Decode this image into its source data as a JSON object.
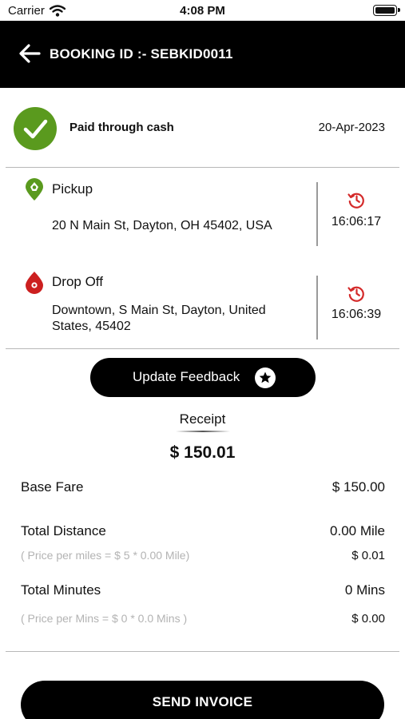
{
  "status_bar": {
    "carrier": "Carrier",
    "time": "4:08 PM"
  },
  "header": {
    "title": "BOOKING ID :- SEBKID0011",
    "back_icon": "arrow-left-icon"
  },
  "payment": {
    "label": "Paid through cash",
    "date": "20-Apr-2023",
    "icon": "check-circle-icon",
    "color": "#5a9a1e"
  },
  "pickup": {
    "title": "Pickup",
    "address": "20 N Main St, Dayton, OH 45402, USA",
    "time": "16:06:17",
    "icon": "pickup-pin-icon",
    "color": "#5a9a1e"
  },
  "dropoff": {
    "title": "Drop Off",
    "address": "Downtown, S Main St, Dayton, United States, 45402",
    "time": "16:06:39",
    "icon": "dropoff-pin-icon",
    "color": "#cc1f1f"
  },
  "feedback": {
    "label": "Update Feedback",
    "icon": "star-icon"
  },
  "receipt": {
    "title": "Receipt",
    "total": "$ 150.01",
    "base_fare": {
      "label": "Base Fare",
      "value": "$ 150.00"
    },
    "distance": {
      "label": "Total Distance",
      "value": "0.00 Mile",
      "note": "( Price per miles = $ 5 * 0.00 Mile)",
      "note_value": "$ 0.01"
    },
    "minutes": {
      "label": "Total Minutes",
      "value": "0 Mins",
      "note": "( Price per Mins = $ 0 * 0.0 Mins )",
      "note_value": "$ 0.00"
    }
  },
  "invoice": {
    "label": "SEND INVOICE"
  }
}
